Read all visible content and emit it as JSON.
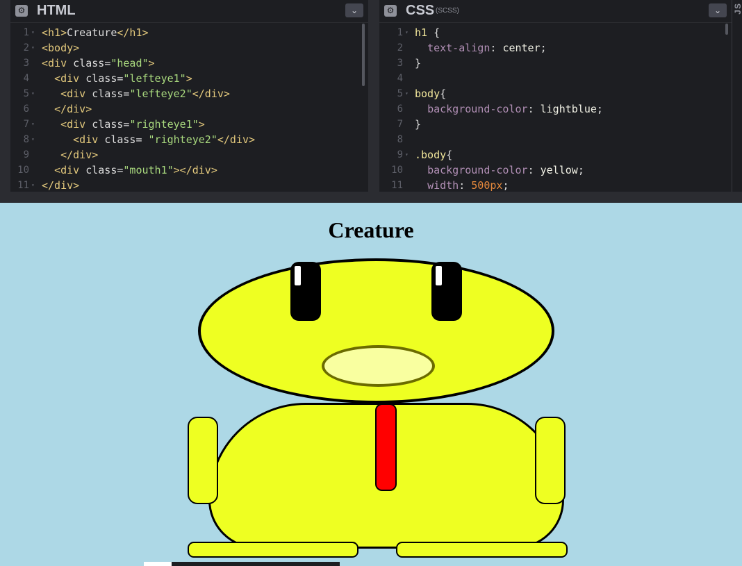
{
  "html_panel": {
    "title": "HTML",
    "gear_icon": "gear-icon",
    "collapse_icon": "chevron-down-icon",
    "lines": [
      {
        "n": "1",
        "fold": true,
        "parts": [
          [
            "tag",
            "<h1>"
          ],
          [
            "t",
            "Creature"
          ],
          [
            "tag",
            "</h1>"
          ]
        ]
      },
      {
        "n": "2",
        "fold": true,
        "parts": [
          [
            "tag",
            "<body>"
          ]
        ]
      },
      {
        "n": "3",
        "fold": false,
        "parts": [
          [
            "tag",
            "<div "
          ],
          [
            "attr",
            "class"
          ],
          [
            "t",
            "="
          ],
          [
            "str",
            "\"head\""
          ],
          [
            "tag",
            ">"
          ]
        ]
      },
      {
        "n": "4",
        "fold": false,
        "parts": [
          [
            "t",
            "  "
          ],
          [
            "tag",
            "<div "
          ],
          [
            "attr",
            "class"
          ],
          [
            "t",
            "="
          ],
          [
            "str",
            "\"lefteye1\""
          ],
          [
            "tag",
            ">"
          ]
        ]
      },
      {
        "n": "5",
        "fold": true,
        "parts": [
          [
            "t",
            "   "
          ],
          [
            "tag",
            "<div "
          ],
          [
            "attr",
            "class"
          ],
          [
            "t",
            "="
          ],
          [
            "str",
            "\"lefteye2\""
          ],
          [
            "tag",
            "</div>"
          ]
        ]
      },
      {
        "n": "6",
        "fold": false,
        "parts": [
          [
            "t",
            "  "
          ],
          [
            "tag",
            "</div>"
          ]
        ]
      },
      {
        "n": "7",
        "fold": true,
        "parts": [
          [
            "t",
            "   "
          ],
          [
            "tag",
            "<div "
          ],
          [
            "attr",
            "class"
          ],
          [
            "t",
            "="
          ],
          [
            "str",
            "\"righteye1\""
          ],
          [
            "tag",
            ">"
          ]
        ]
      },
      {
        "n": "8",
        "fold": true,
        "parts": [
          [
            "t",
            "     "
          ],
          [
            "tag",
            "<div "
          ],
          [
            "attr",
            "class"
          ],
          [
            "t",
            "= "
          ],
          [
            "str",
            "\"righteye2\""
          ],
          [
            "tag",
            "</div>"
          ]
        ]
      },
      {
        "n": "9",
        "fold": false,
        "parts": [
          [
            "t",
            "   "
          ],
          [
            "tag",
            "</div>"
          ]
        ]
      },
      {
        "n": "10",
        "fold": false,
        "parts": [
          [
            "t",
            "  "
          ],
          [
            "tag",
            "<div "
          ],
          [
            "attr",
            "class"
          ],
          [
            "t",
            "="
          ],
          [
            "str",
            "\"mouth1\""
          ],
          [
            "tag",
            "></div>"
          ]
        ]
      },
      {
        "n": "11",
        "fold": true,
        "parts": [
          [
            "tag",
            "</div>"
          ]
        ]
      }
    ]
  },
  "css_panel": {
    "title": "CSS",
    "subtitle": "(SCSS)",
    "gear_icon": "gear-icon",
    "collapse_icon": "chevron-down-icon",
    "lines": [
      {
        "n": "1",
        "fold": true,
        "parts": [
          [
            "sel",
            "h1"
          ],
          [
            "t",
            " {"
          ]
        ]
      },
      {
        "n": "2",
        "fold": false,
        "parts": [
          [
            "t",
            "  "
          ],
          [
            "prop",
            "text-align"
          ],
          [
            "t",
            ": "
          ],
          [
            "val",
            "center"
          ],
          [
            "t",
            ";"
          ]
        ]
      },
      {
        "n": "3",
        "fold": false,
        "parts": [
          [
            "t",
            "}"
          ]
        ]
      },
      {
        "n": "4",
        "fold": false,
        "parts": []
      },
      {
        "n": "5",
        "fold": true,
        "parts": [
          [
            "sel",
            "body"
          ],
          [
            "t",
            "{"
          ]
        ]
      },
      {
        "n": "6",
        "fold": false,
        "parts": [
          [
            "t",
            "  "
          ],
          [
            "prop",
            "background-color"
          ],
          [
            "t",
            ": "
          ],
          [
            "val",
            "lightblue"
          ],
          [
            "t",
            ";"
          ]
        ]
      },
      {
        "n": "7",
        "fold": false,
        "parts": [
          [
            "t",
            "}"
          ]
        ]
      },
      {
        "n": "8",
        "fold": false,
        "parts": []
      },
      {
        "n": "9",
        "fold": true,
        "parts": [
          [
            "sel",
            ".body"
          ],
          [
            "t",
            "{"
          ]
        ]
      },
      {
        "n": "10",
        "fold": false,
        "parts": [
          [
            "t",
            "  "
          ],
          [
            "prop",
            "background-color"
          ],
          [
            "t",
            ": "
          ],
          [
            "val",
            "yellow"
          ],
          [
            "t",
            ";"
          ]
        ]
      },
      {
        "n": "11",
        "fold": false,
        "parts": [
          [
            "t",
            "  "
          ],
          [
            "prop",
            "width"
          ],
          [
            "t",
            ": "
          ],
          [
            "num",
            "500px"
          ],
          [
            "t",
            ";"
          ]
        ]
      }
    ]
  },
  "js_panel": {
    "label": "JS"
  },
  "preview": {
    "heading": "Creature",
    "colors": {
      "background": "#add8e6",
      "creature_body": "#eeff22",
      "mouth": "#f9ffa0",
      "tie": "#ff0000",
      "outline": "#000000"
    }
  }
}
